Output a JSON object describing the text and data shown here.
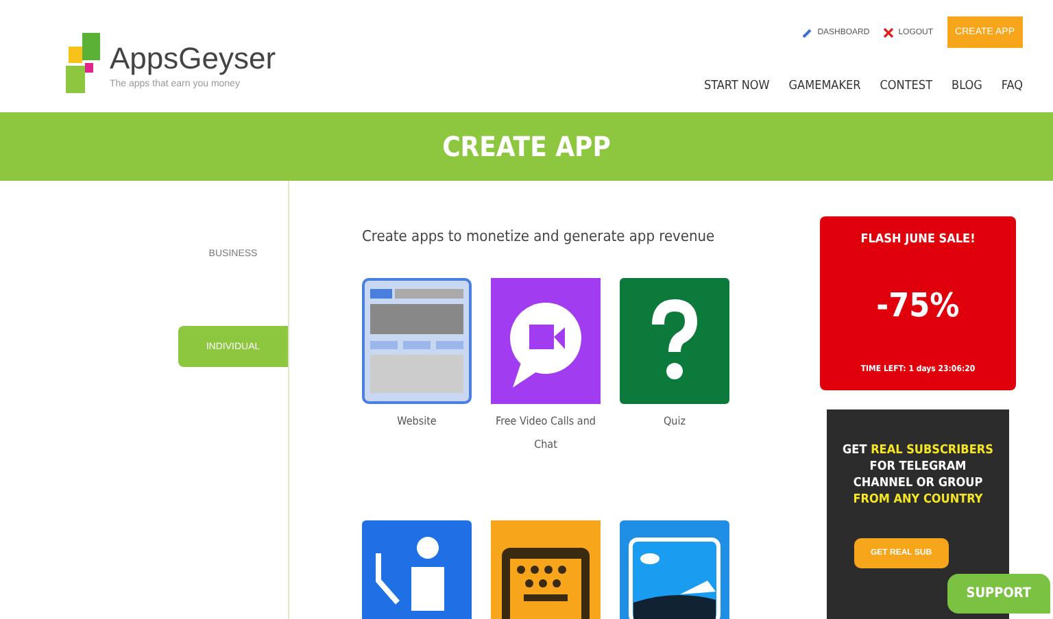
{
  "header": {
    "logo_text": "AppsGeyser",
    "tagline": "The apps that earn you money",
    "top_links": [
      {
        "kind": "dashboard",
        "label": "DASHBOARD"
      },
      {
        "kind": "logout",
        "label": "LOGOUT"
      }
    ],
    "create_button": "CREATE APP",
    "nav": [
      "START NOW",
      "GAMEMAKER",
      "CONTEST",
      "BLOG",
      "FAQ"
    ]
  },
  "banner": {
    "title": "CREATE APP"
  },
  "sidebar": {
    "items": [
      {
        "label": "BUSINESS",
        "selected": false
      },
      {
        "label": "INDIVIDUAL",
        "selected": true
      }
    ]
  },
  "content": {
    "heading": "Create apps to monetize and generate app revenue",
    "tiles": [
      {
        "kind": "website",
        "label": "Website"
      },
      {
        "kind": "video",
        "label": "Free Video Calls and Chat"
      },
      {
        "kind": "quiz",
        "label": "Quiz"
      },
      {
        "kind": "manual"
      },
      {
        "kind": "keyboard"
      },
      {
        "kind": "photo"
      }
    ]
  },
  "sale_ad": {
    "title": "FLASH JUNE SALE!",
    "discount": "-75%",
    "timer": "TIME LEFT: 1 days 23:06:20"
  },
  "telegram_ad": {
    "text": "GET **REAL SUBSCRIBERS** FOR TELEGRAM CHANNEL OR GROUP **FROM ANY COUNTRY**",
    "button": "GET REAL SUB"
  },
  "support_button": "SUPPORT"
}
